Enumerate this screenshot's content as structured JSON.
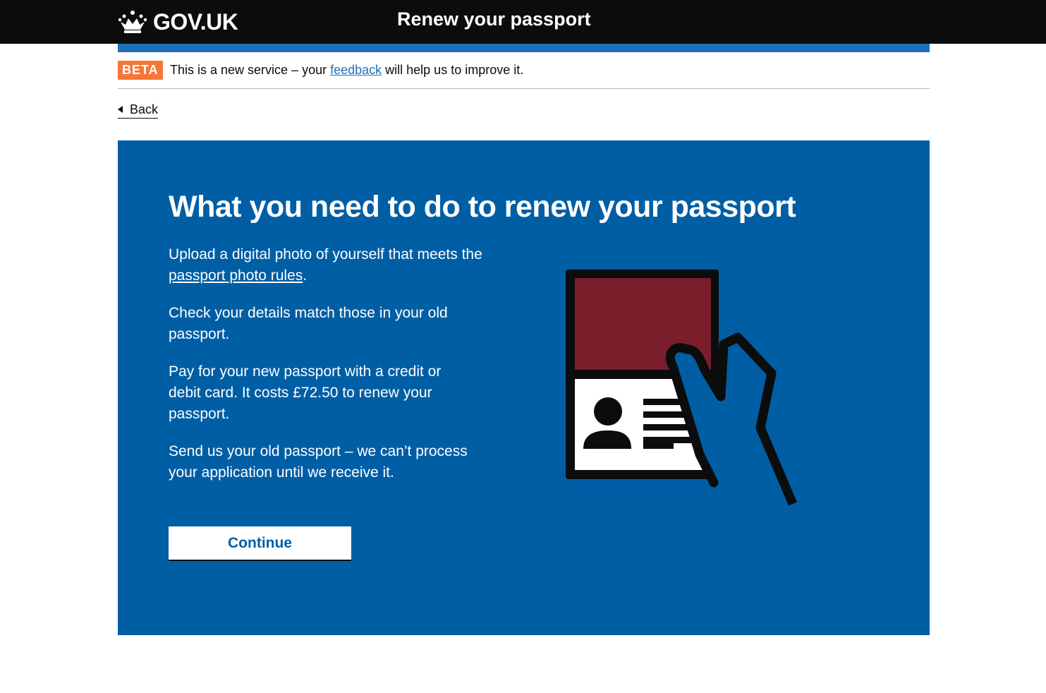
{
  "header": {
    "logo_text": "GOV.UK",
    "logo_icon": "crown-icon",
    "service_name": "Renew your passport"
  },
  "phase_banner": {
    "tag": "BETA",
    "text_before": "This is a new service – your ",
    "link_text": "feedback",
    "text_after": " will help us to improve it."
  },
  "back_link": {
    "label": "Back"
  },
  "panel": {
    "title": "What you need to do to renew your passport",
    "para1_before": "Upload a digital photo of yourself that meets the ",
    "para1_link": "passport photo rules",
    "para1_after": ".",
    "para2": "Check your details match those in your old passport.",
    "para3": "Pay for your new passport with a credit or debit card. It costs £72.50 to renew your passport.",
    "para4": "Send us your old passport – we can’t process your application until we receive it.",
    "continue_label": "Continue",
    "illustration_icon": "passport-in-hand-icon"
  },
  "colors": {
    "header_bg": "#0b0c0c",
    "accent_blue": "#1d70b8",
    "panel_blue": "#005ea5",
    "beta_orange": "#f47738",
    "passport_red": "#7a1e2b"
  }
}
